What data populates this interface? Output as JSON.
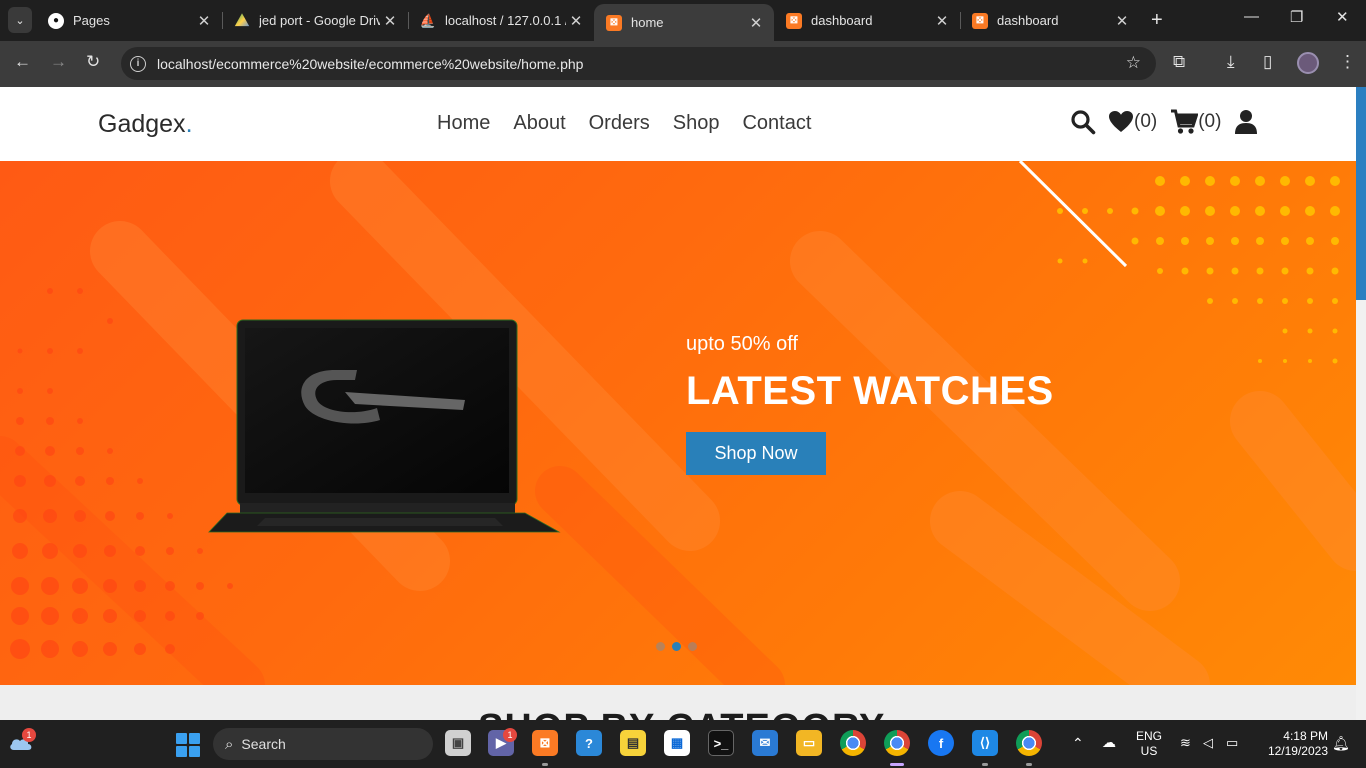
{
  "browser": {
    "tabs": [
      {
        "title": "Pages",
        "icon": "github-icon",
        "active": false
      },
      {
        "title": "jed port - Google Drive",
        "icon": "google-drive-icon",
        "active": false
      },
      {
        "title": "localhost / 127.0.0.1 / ",
        "icon": "phpmyadmin-icon",
        "active": false
      },
      {
        "title": "home",
        "icon": "xampp-icon",
        "active": true
      },
      {
        "title": "dashboard",
        "icon": "xampp-icon",
        "active": false
      },
      {
        "title": "dashboard",
        "icon": "xampp-icon",
        "active": false
      }
    ],
    "url": "localhost/ecommerce%20website/ecommerce%20website/home.php"
  },
  "site": {
    "logo_text": "Gadgex",
    "logo_dot": ".",
    "nav": [
      "Home",
      "About",
      "Orders",
      "Shop",
      "Contact"
    ],
    "wishlist_count": "(0)",
    "cart_count": "(0)",
    "accent_color": "#2980b9"
  },
  "hero": {
    "subtitle": "upto 50% off",
    "title": "LATEST WATCHES",
    "button_label": "Shop Now",
    "slides": 3,
    "active_slide": 2
  },
  "section": {
    "heading": "SHOP BY CATEGORY"
  },
  "taskbar": {
    "search_label": "Search",
    "weather_badge": "1",
    "teams_badge": "1",
    "lang_line1": "ENG",
    "lang_line2": "US",
    "time": "4:18 PM",
    "date": "12/19/2023"
  }
}
